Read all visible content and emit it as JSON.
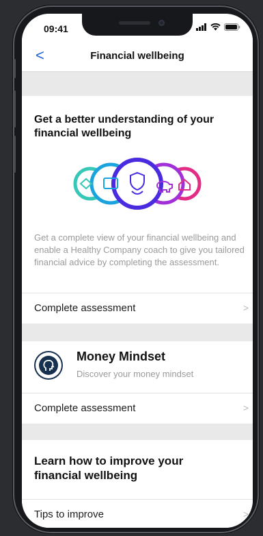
{
  "status": {
    "time": "09:41"
  },
  "nav": {
    "title": "Financial wellbeing",
    "back_glyph": "<"
  },
  "understanding": {
    "heading": "Get a better understanding of your financial wellbeing",
    "description": "Get a complete view of your financial wellbeing and enable a Healthy Company coach to give you tailored financial advice by completing the assessment.",
    "action": "Complete assessment",
    "circle_colors": [
      "#36c7b7",
      "#1aa3dd",
      "#4b2be0",
      "#a230d8",
      "#e22c86"
    ]
  },
  "mindset": {
    "title": "Money Mindset",
    "subtitle": "Discover your money mindset",
    "action": "Complete assessment"
  },
  "improve": {
    "heading": "Learn how to improve your financial wellbeing",
    "action": "Tips to improve"
  },
  "chevron_glyph": ">"
}
